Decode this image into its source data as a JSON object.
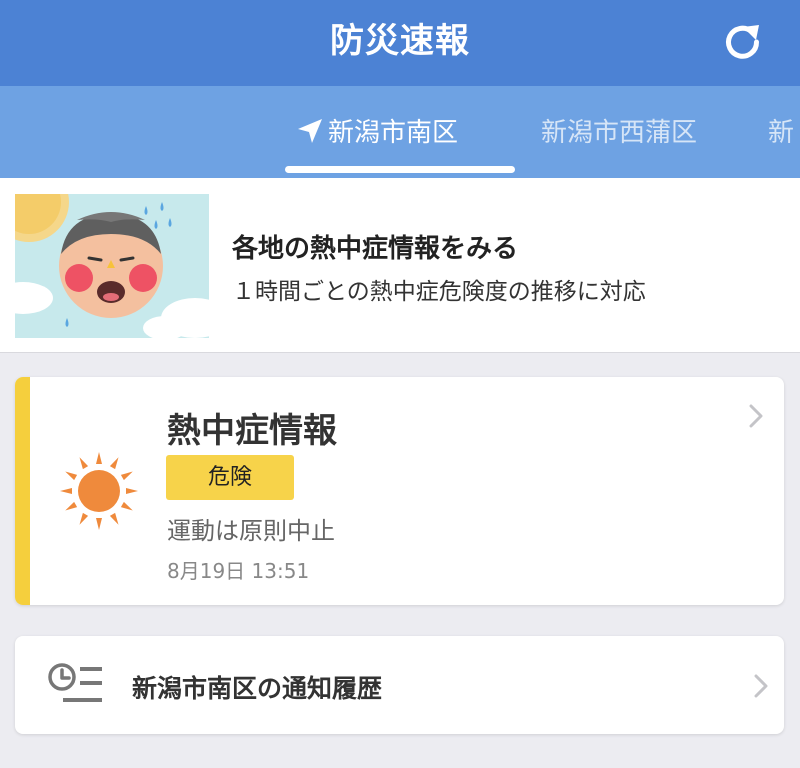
{
  "header": {
    "title": "防災速報",
    "refresh_icon": "refresh-icon",
    "background_color": "#4c82d4"
  },
  "tabs": [
    {
      "label": "新潟市南区",
      "active": true,
      "icon": "location-arrow-icon"
    },
    {
      "label": "新潟市西蒲区",
      "active": false
    },
    {
      "label": "新",
      "active": false
    }
  ],
  "banner": {
    "title": "各地の熱中症情報をみる",
    "subtitle": "１時間ごとの熱中症危険度の推移に対応"
  },
  "heatstroke_card": {
    "title": "熱中症情報",
    "level": "危険",
    "advice": "運動は原則中止",
    "timestamp": "8月19日 13:51",
    "accent_color": "#f5cf3d",
    "icon": "sun-icon"
  },
  "history_card": {
    "label": "新潟市南区の通知履歴",
    "icon": "history-icon"
  }
}
